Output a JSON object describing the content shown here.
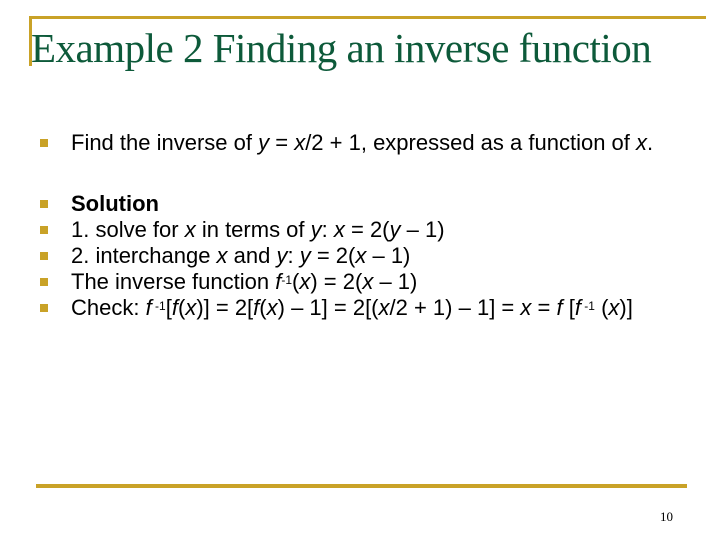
{
  "slide": {
    "title": "Example 2 Finding an inverse function",
    "page_number": "10",
    "accent_color": "#c9a227",
    "title_color": "#0d5a3a",
    "bullets": [
      {
        "id": "problem",
        "segments": [
          {
            "t": "Find the inverse of "
          },
          {
            "t": "y",
            "i": true
          },
          {
            "t": " = "
          },
          {
            "t": "x",
            "i": true
          },
          {
            "t": "/2 + 1, expressed as a function of "
          },
          {
            "t": "x",
            "i": true
          },
          {
            "t": "."
          }
        ]
      },
      {
        "id": "solution",
        "segments": [
          {
            "t": "Solution",
            "b": true
          }
        ]
      },
      {
        "id": "step1",
        "segments": [
          {
            "t": "1. solve for "
          },
          {
            "t": "x",
            "i": true
          },
          {
            "t": " in terms of "
          },
          {
            "t": "y",
            "i": true
          },
          {
            "t": ": "
          },
          {
            "t": "x",
            "i": true
          },
          {
            "t": "  = 2("
          },
          {
            "t": "y",
            "i": true
          },
          {
            "t": " – 1)"
          }
        ]
      },
      {
        "id": "step2",
        "segments": [
          {
            "t": "2. interchange "
          },
          {
            "t": "x",
            "i": true
          },
          {
            "t": " and "
          },
          {
            "t": "y",
            "i": true
          },
          {
            "t": ": "
          },
          {
            "t": "y",
            "i": true
          },
          {
            "t": " = 2("
          },
          {
            "t": "x",
            "i": true
          },
          {
            "t": " – 1)"
          }
        ]
      },
      {
        "id": "inverse",
        "segments": [
          {
            "t": "The inverse function "
          },
          {
            "t": "f",
            "i": true
          },
          {
            "t": "-1",
            "sup": true
          },
          {
            "t": "("
          },
          {
            "t": "x",
            "i": true
          },
          {
            "t": ") = 2("
          },
          {
            "t": "x",
            "i": true
          },
          {
            "t": " – 1)"
          }
        ]
      },
      {
        "id": "check",
        "segments": [
          {
            "t": "Check: "
          },
          {
            "t": "f",
            "i": true
          },
          {
            "t": " -1",
            "sup": true
          },
          {
            "t": "["
          },
          {
            "t": "f",
            "i": true
          },
          {
            "t": "("
          },
          {
            "t": "x",
            "i": true
          },
          {
            "t": ")] = 2["
          },
          {
            "t": "f",
            "i": true
          },
          {
            "t": "("
          },
          {
            "t": "x",
            "i": true
          },
          {
            "t": ") – 1] = 2[("
          },
          {
            "t": "x",
            "i": true
          },
          {
            "t": "/2 + 1) – 1] = "
          },
          {
            "t": "x",
            "i": true
          },
          {
            "t": " = "
          },
          {
            "t": "f",
            "i": true
          },
          {
            "t": " ["
          },
          {
            "t": "f",
            "i": true
          },
          {
            "t": " -1",
            "sup": true
          },
          {
            "t": " ("
          },
          {
            "t": "x",
            "i": true
          },
          {
            "t": ")]"
          }
        ]
      }
    ]
  }
}
